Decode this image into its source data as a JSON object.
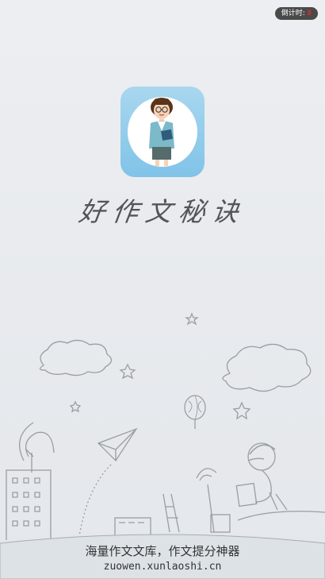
{
  "countdown": {
    "label": "倒计时:",
    "value": "3"
  },
  "app": {
    "name": "好作文秘诀"
  },
  "footer": {
    "tagline": "海量作文文库，作文提分神器",
    "url": "zuowen.xunlaoshi.cn"
  },
  "icons": [
    "teacher-avatar-icon",
    "paper-plane-icon",
    "cloud-icon",
    "star-icon",
    "balloon-icon",
    "reading-kid-icon"
  ]
}
